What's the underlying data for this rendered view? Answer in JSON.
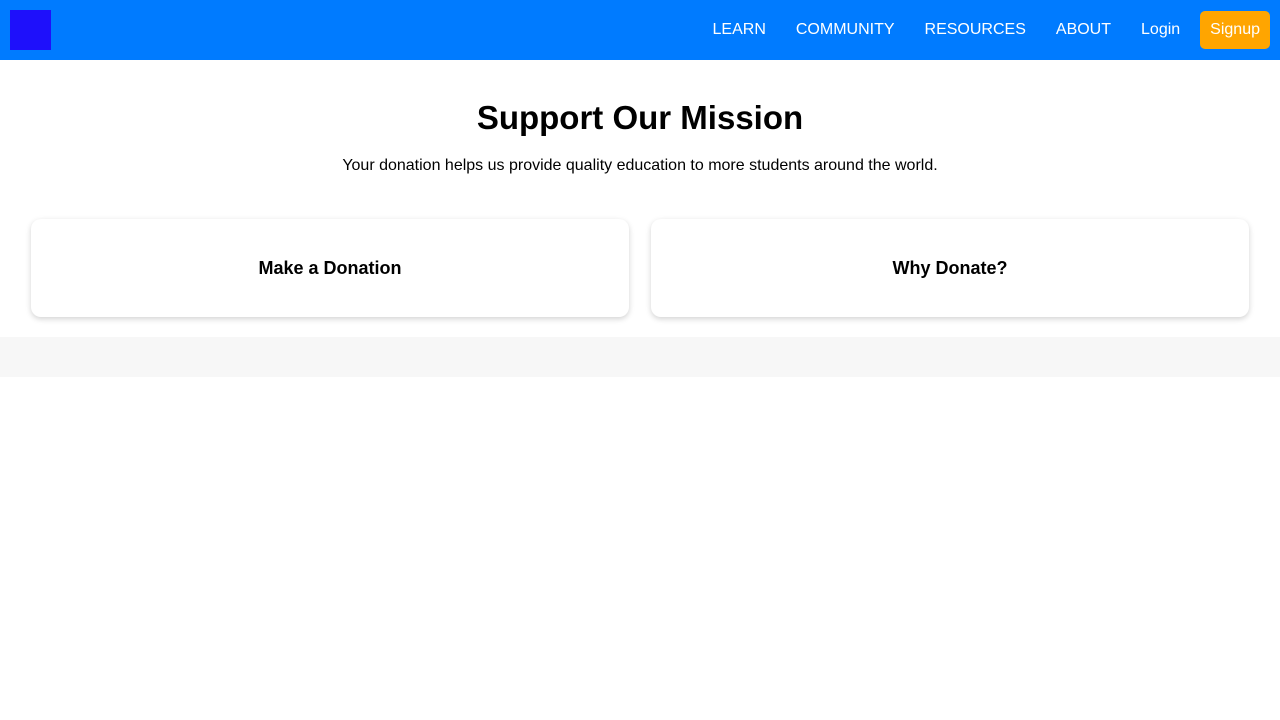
{
  "colors": {
    "navbar_bg": "#007bff",
    "logo_bg": "#1e10fb",
    "signup_bg": "#ffa500",
    "footer_bg": "#f7f7f7"
  },
  "nav": {
    "items": [
      "LEARN",
      "COMMUNITY",
      "RESOURCES",
      "ABOUT"
    ],
    "login_label": "Login",
    "signup_label": "Signup"
  },
  "hero": {
    "title": "Support Our Mission",
    "subtitle": "Your donation helps us provide quality education to more students around the world."
  },
  "cards": [
    {
      "title": "Make a Donation"
    },
    {
      "title": "Why Donate?"
    }
  ]
}
